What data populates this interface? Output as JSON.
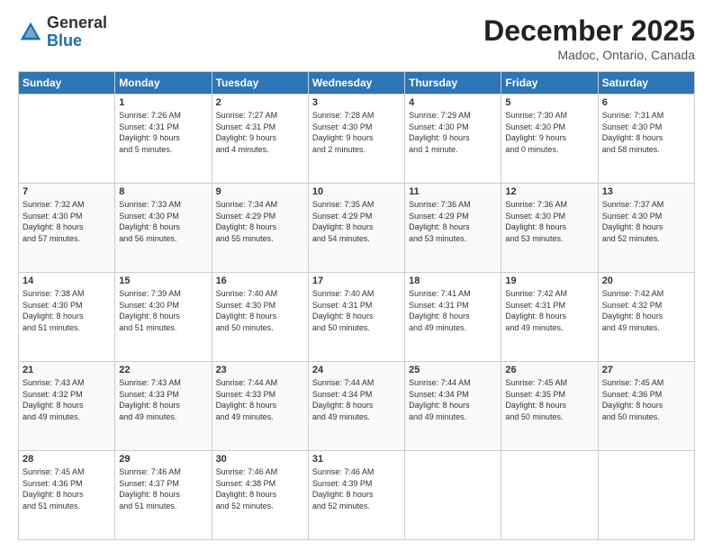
{
  "logo": {
    "general": "General",
    "blue": "Blue"
  },
  "header": {
    "month": "December 2025",
    "location": "Madoc, Ontario, Canada"
  },
  "days_of_week": [
    "Sunday",
    "Monday",
    "Tuesday",
    "Wednesday",
    "Thursday",
    "Friday",
    "Saturday"
  ],
  "weeks": [
    [
      {
        "day": "",
        "info": ""
      },
      {
        "day": "1",
        "info": "Sunrise: 7:26 AM\nSunset: 4:31 PM\nDaylight: 9 hours\nand 5 minutes."
      },
      {
        "day": "2",
        "info": "Sunrise: 7:27 AM\nSunset: 4:31 PM\nDaylight: 9 hours\nand 4 minutes."
      },
      {
        "day": "3",
        "info": "Sunrise: 7:28 AM\nSunset: 4:30 PM\nDaylight: 9 hours\nand 2 minutes."
      },
      {
        "day": "4",
        "info": "Sunrise: 7:29 AM\nSunset: 4:30 PM\nDaylight: 9 hours\nand 1 minute."
      },
      {
        "day": "5",
        "info": "Sunrise: 7:30 AM\nSunset: 4:30 PM\nDaylight: 9 hours\nand 0 minutes."
      },
      {
        "day": "6",
        "info": "Sunrise: 7:31 AM\nSunset: 4:30 PM\nDaylight: 8 hours\nand 58 minutes."
      }
    ],
    [
      {
        "day": "7",
        "info": "Sunrise: 7:32 AM\nSunset: 4:30 PM\nDaylight: 8 hours\nand 57 minutes."
      },
      {
        "day": "8",
        "info": "Sunrise: 7:33 AM\nSunset: 4:30 PM\nDaylight: 8 hours\nand 56 minutes."
      },
      {
        "day": "9",
        "info": "Sunrise: 7:34 AM\nSunset: 4:29 PM\nDaylight: 8 hours\nand 55 minutes."
      },
      {
        "day": "10",
        "info": "Sunrise: 7:35 AM\nSunset: 4:29 PM\nDaylight: 8 hours\nand 54 minutes."
      },
      {
        "day": "11",
        "info": "Sunrise: 7:36 AM\nSunset: 4:29 PM\nDaylight: 8 hours\nand 53 minutes."
      },
      {
        "day": "12",
        "info": "Sunrise: 7:36 AM\nSunset: 4:30 PM\nDaylight: 8 hours\nand 53 minutes."
      },
      {
        "day": "13",
        "info": "Sunrise: 7:37 AM\nSunset: 4:30 PM\nDaylight: 8 hours\nand 52 minutes."
      }
    ],
    [
      {
        "day": "14",
        "info": "Sunrise: 7:38 AM\nSunset: 4:30 PM\nDaylight: 8 hours\nand 51 minutes."
      },
      {
        "day": "15",
        "info": "Sunrise: 7:39 AM\nSunset: 4:30 PM\nDaylight: 8 hours\nand 51 minutes."
      },
      {
        "day": "16",
        "info": "Sunrise: 7:40 AM\nSunset: 4:30 PM\nDaylight: 8 hours\nand 50 minutes."
      },
      {
        "day": "17",
        "info": "Sunrise: 7:40 AM\nSunset: 4:31 PM\nDaylight: 8 hours\nand 50 minutes."
      },
      {
        "day": "18",
        "info": "Sunrise: 7:41 AM\nSunset: 4:31 PM\nDaylight: 8 hours\nand 49 minutes."
      },
      {
        "day": "19",
        "info": "Sunrise: 7:42 AM\nSunset: 4:31 PM\nDaylight: 8 hours\nand 49 minutes."
      },
      {
        "day": "20",
        "info": "Sunrise: 7:42 AM\nSunset: 4:32 PM\nDaylight: 8 hours\nand 49 minutes."
      }
    ],
    [
      {
        "day": "21",
        "info": "Sunrise: 7:43 AM\nSunset: 4:32 PM\nDaylight: 8 hours\nand 49 minutes."
      },
      {
        "day": "22",
        "info": "Sunrise: 7:43 AM\nSunset: 4:33 PM\nDaylight: 8 hours\nand 49 minutes."
      },
      {
        "day": "23",
        "info": "Sunrise: 7:44 AM\nSunset: 4:33 PM\nDaylight: 8 hours\nand 49 minutes."
      },
      {
        "day": "24",
        "info": "Sunrise: 7:44 AM\nSunset: 4:34 PM\nDaylight: 8 hours\nand 49 minutes."
      },
      {
        "day": "25",
        "info": "Sunrise: 7:44 AM\nSunset: 4:34 PM\nDaylight: 8 hours\nand 49 minutes."
      },
      {
        "day": "26",
        "info": "Sunrise: 7:45 AM\nSunset: 4:35 PM\nDaylight: 8 hours\nand 50 minutes."
      },
      {
        "day": "27",
        "info": "Sunrise: 7:45 AM\nSunset: 4:36 PM\nDaylight: 8 hours\nand 50 minutes."
      }
    ],
    [
      {
        "day": "28",
        "info": "Sunrise: 7:45 AM\nSunset: 4:36 PM\nDaylight: 8 hours\nand 51 minutes."
      },
      {
        "day": "29",
        "info": "Sunrise: 7:46 AM\nSunset: 4:37 PM\nDaylight: 8 hours\nand 51 minutes."
      },
      {
        "day": "30",
        "info": "Sunrise: 7:46 AM\nSunset: 4:38 PM\nDaylight: 8 hours\nand 52 minutes."
      },
      {
        "day": "31",
        "info": "Sunrise: 7:46 AM\nSunset: 4:39 PM\nDaylight: 8 hours\nand 52 minutes."
      },
      {
        "day": "",
        "info": ""
      },
      {
        "day": "",
        "info": ""
      },
      {
        "day": "",
        "info": ""
      }
    ]
  ]
}
